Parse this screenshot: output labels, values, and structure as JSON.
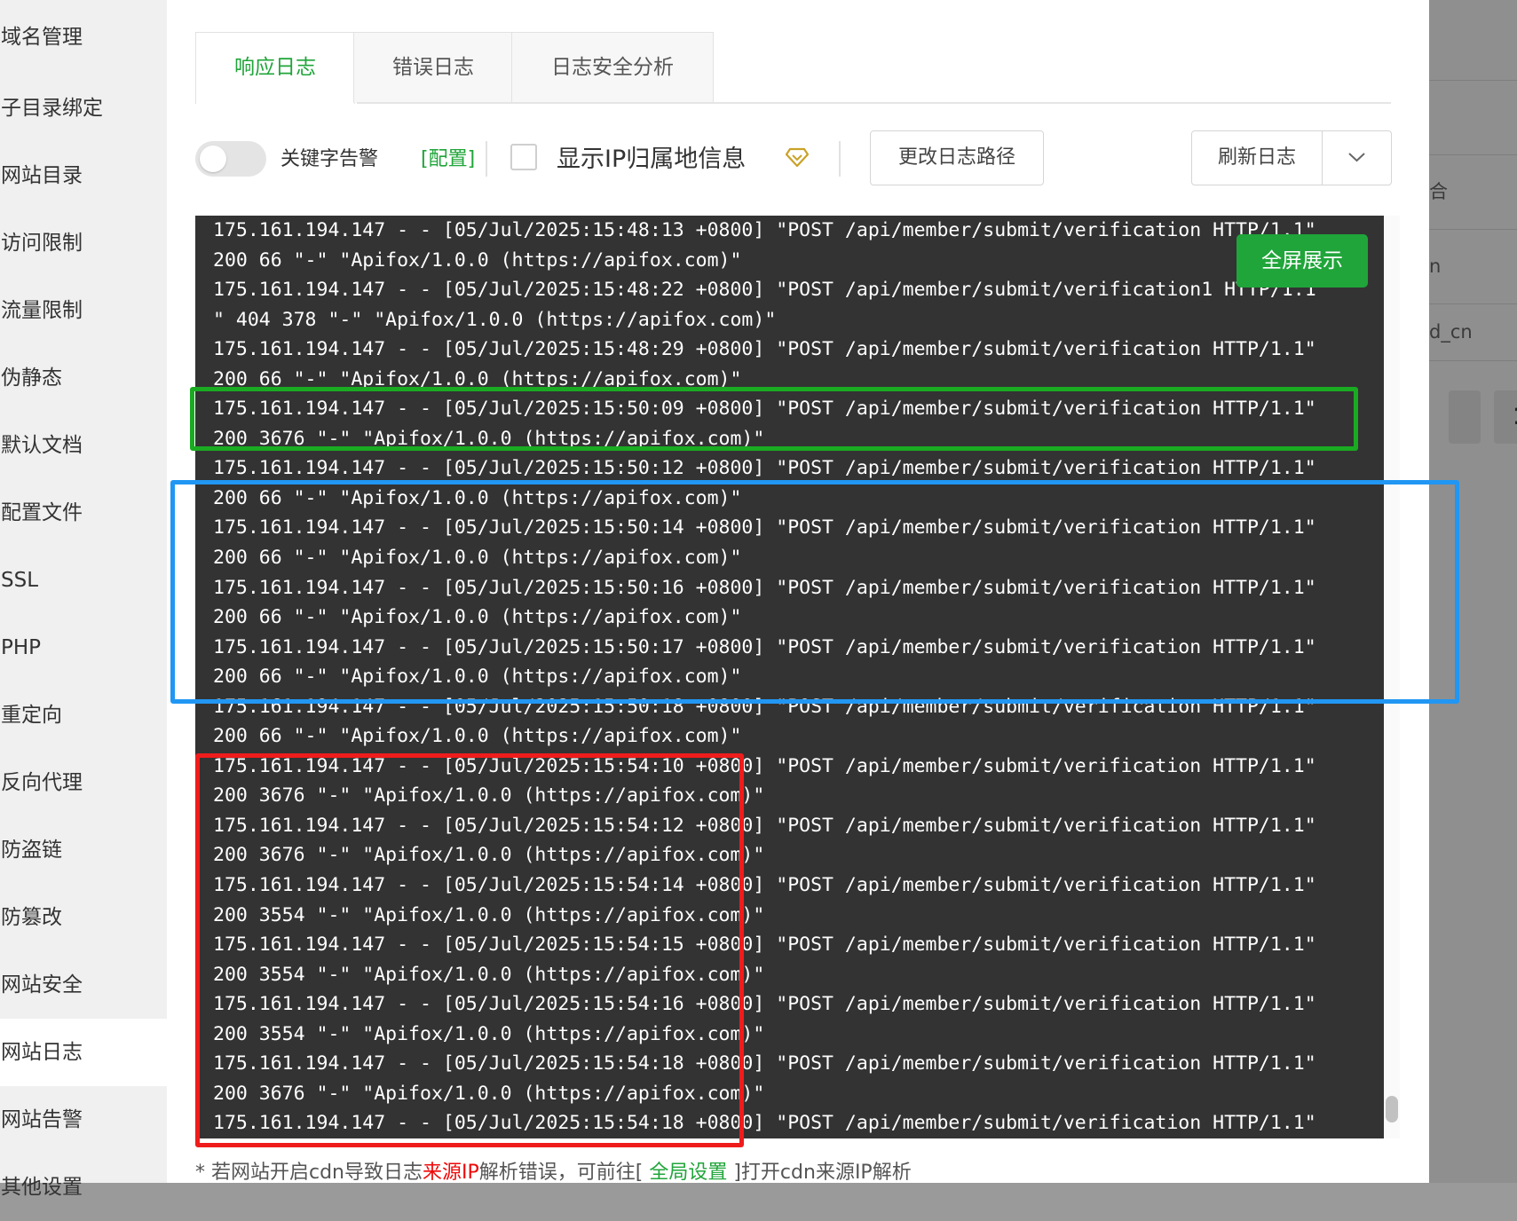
{
  "sidebar": {
    "items": [
      "域名管理",
      "子目录绑定",
      "网站目录",
      "访问限制",
      "流量限制",
      "伪静态",
      "默认文档",
      "配置文件",
      "SSL",
      "PHP",
      "重定向",
      "反向代理",
      "防盗链",
      "防篡改",
      "网站安全",
      "网站日志",
      "网站告警",
      "其他设置"
    ],
    "active": "网站日志"
  },
  "tabs": [
    {
      "label": "响应日志",
      "active": true
    },
    {
      "label": "错误日志",
      "active": false
    },
    {
      "label": "日志安全分析",
      "active": false
    }
  ],
  "toolbar": {
    "keyword_alert_label": "关键字告警",
    "keyword_config_link": "[配置]",
    "keyword_alert_enabled": false,
    "show_ip_label": "显示IP归属地信息",
    "show_ip_checked": false,
    "change_path_button": "更改日志路径",
    "refresh_button": "刷新日志"
  },
  "fullscreen_button": "全屏展示",
  "log_lines": [
    "175.161.194.147 - - [05/Jul/2025:15:48:13 +0800] \"POST /api/member/submit/verification HTTP/1.1\"",
    "200 66 \"-\" \"Apifox/1.0.0 (https://apifox.com)\"",
    "175.161.194.147 - - [05/Jul/2025:15:48:22 +0800] \"POST /api/member/submit/verification1 HTTP/1.1",
    "\" 404 378 \"-\" \"Apifox/1.0.0 (https://apifox.com)\"",
    "175.161.194.147 - - [05/Jul/2025:15:48:29 +0800] \"POST /api/member/submit/verification HTTP/1.1\"",
    "200 66 \"-\" \"Apifox/1.0.0 (https://apifox.com)\"",
    "175.161.194.147 - - [05/Jul/2025:15:50:09 +0800] \"POST /api/member/submit/verification HTTP/1.1\"",
    "200 3676 \"-\" \"Apifox/1.0.0 (https://apifox.com)\"",
    "175.161.194.147 - - [05/Jul/2025:15:50:12 +0800] \"POST /api/member/submit/verification HTTP/1.1\"",
    "200 66 \"-\" \"Apifox/1.0.0 (https://apifox.com)\"",
    "175.161.194.147 - - [05/Jul/2025:15:50:14 +0800] \"POST /api/member/submit/verification HTTP/1.1\"",
    "200 66 \"-\" \"Apifox/1.0.0 (https://apifox.com)\"",
    "175.161.194.147 - - [05/Jul/2025:15:50:16 +0800] \"POST /api/member/submit/verification HTTP/1.1\"",
    "200 66 \"-\" \"Apifox/1.0.0 (https://apifox.com)\"",
    "175.161.194.147 - - [05/Jul/2025:15:50:17 +0800] \"POST /api/member/submit/verification HTTP/1.1\"",
    "200 66 \"-\" \"Apifox/1.0.0 (https://apifox.com)\"",
    "175.161.194.147 - - [05/Jul/2025:15:50:18 +0800] \"POST /api/member/submit/verification HTTP/1.1\"",
    "200 66 \"-\" \"Apifox/1.0.0 (https://apifox.com)\"",
    "175.161.194.147 - - [05/Jul/2025:15:54:10 +0800] \"POST /api/member/submit/verification HTTP/1.1\"",
    "200 3676 \"-\" \"Apifox/1.0.0 (https://apifox.com)\"",
    "175.161.194.147 - - [05/Jul/2025:15:54:12 +0800] \"POST /api/member/submit/verification HTTP/1.1\"",
    "200 3676 \"-\" \"Apifox/1.0.0 (https://apifox.com)\"",
    "175.161.194.147 - - [05/Jul/2025:15:54:14 +0800] \"POST /api/member/submit/verification HTTP/1.1\"",
    "200 3554 \"-\" \"Apifox/1.0.0 (https://apifox.com)\"",
    "175.161.194.147 - - [05/Jul/2025:15:54:15 +0800] \"POST /api/member/submit/verification HTTP/1.1\"",
    "200 3554 \"-\" \"Apifox/1.0.0 (https://apifox.com)\"",
    "175.161.194.147 - - [05/Jul/2025:15:54:16 +0800] \"POST /api/member/submit/verification HTTP/1.1\"",
    "200 3554 \"-\" \"Apifox/1.0.0 (https://apifox.com)\"",
    "175.161.194.147 - - [05/Jul/2025:15:54:18 +0800] \"POST /api/member/submit/verification HTTP/1.1\"",
    "200 3676 \"-\" \"Apifox/1.0.0 (https://apifox.com)\"",
    "175.161.194.147 - - [05/Jul/2025:15:54:18 +0800] \"POST /api/member/submit/verification HTTP/1.1\""
  ],
  "footer": {
    "prefix": "* 若网站开启cdn导致日志",
    "highlight_red": "来源IP",
    "middle": "解析错误，可前往[ ",
    "link": "全局设置",
    "suffix": " ]打开cdn来源IP解析"
  },
  "background_page": {
    "fragments": [
      "合",
      "n",
      "d_cn"
    ],
    "page_number": "1"
  },
  "colors": {
    "accent": "#20a53a",
    "log_background": "#333333",
    "annotation_green": "#1aab22",
    "annotation_blue": "#2196f3",
    "annotation_red": "#ef1c1c",
    "footer_red": "#ef0808"
  }
}
